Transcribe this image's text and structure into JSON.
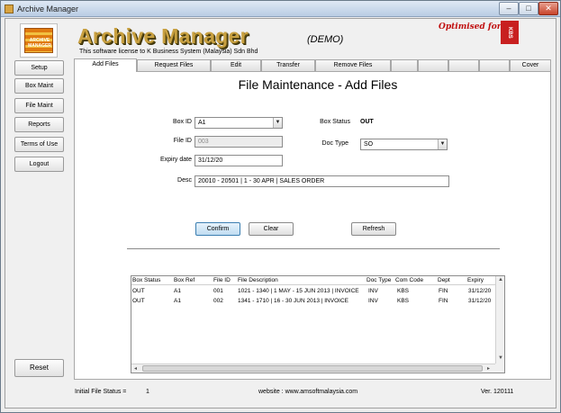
{
  "window": {
    "title": "Archive Manager",
    "controls": {
      "minimize": "–",
      "maximize": "□",
      "close": "✕"
    }
  },
  "header": {
    "logo_text": "ARCHIVE MANAGER",
    "app_title": "Archive Manager",
    "demo": "(DEMO)",
    "license": "This software license to K Business System (Malaysia) Sdn Bhd",
    "optimised": "Optimised for",
    "brand": "KBS"
  },
  "sidebar": {
    "items": [
      {
        "label": "Setup"
      },
      {
        "label": "Box Maint"
      },
      {
        "label": "File Maint"
      },
      {
        "label": "Reports"
      },
      {
        "label": "Terms of Use"
      },
      {
        "label": "Logout"
      }
    ],
    "reset_label": "Reset"
  },
  "tabs": [
    {
      "label": "Add Files",
      "active": true
    },
    {
      "label": "Request Files"
    },
    {
      "label": "Edit"
    },
    {
      "label": "Transfer"
    },
    {
      "label": "Remove Files"
    },
    {
      "label": ""
    },
    {
      "label": ""
    },
    {
      "label": ""
    },
    {
      "label": ""
    },
    {
      "label": "Cover"
    }
  ],
  "form": {
    "title": "File Maintenance - Add Files",
    "box_id_label": "Box ID",
    "box_id_value": "A1",
    "file_id_label": "File ID",
    "file_id_value": "003",
    "expiry_label": "Expiry date",
    "expiry_value": "31/12/20",
    "desc_label": "Desc",
    "desc_value": "20010 - 20501 | 1 - 30 APR | SALES ORDER",
    "box_status_label": "Box Status",
    "box_status_value": "OUT",
    "doc_type_label": "Doc Type",
    "doc_type_value": "SO",
    "confirm_label": "Confirm",
    "clear_label": "Clear",
    "refresh_label": "Refresh"
  },
  "grid": {
    "columns": [
      "Box Status",
      "Box Ref",
      "File ID",
      "File Description",
      "Doc Type",
      "Com Code",
      "Dept",
      "Expiry"
    ],
    "rows": [
      [
        "OUT",
        "A1",
        "001",
        "1021 - 1340 | 1 MAY - 15 JUN 2013 | INVOICE",
        "INV",
        "KBS",
        "FIN",
        "31/12/20"
      ],
      [
        "OUT",
        "A1",
        "002",
        "1341 - 1710 | 16 - 30 JUN 2013 | INVOICE",
        "INV",
        "KBS",
        "FIN",
        "31/12/20"
      ]
    ]
  },
  "status": {
    "initial_label": "Initial File Status =",
    "initial_value": "1",
    "website": "website : www.amsoftmalaysia.com",
    "version": "Ver. 120111"
  }
}
